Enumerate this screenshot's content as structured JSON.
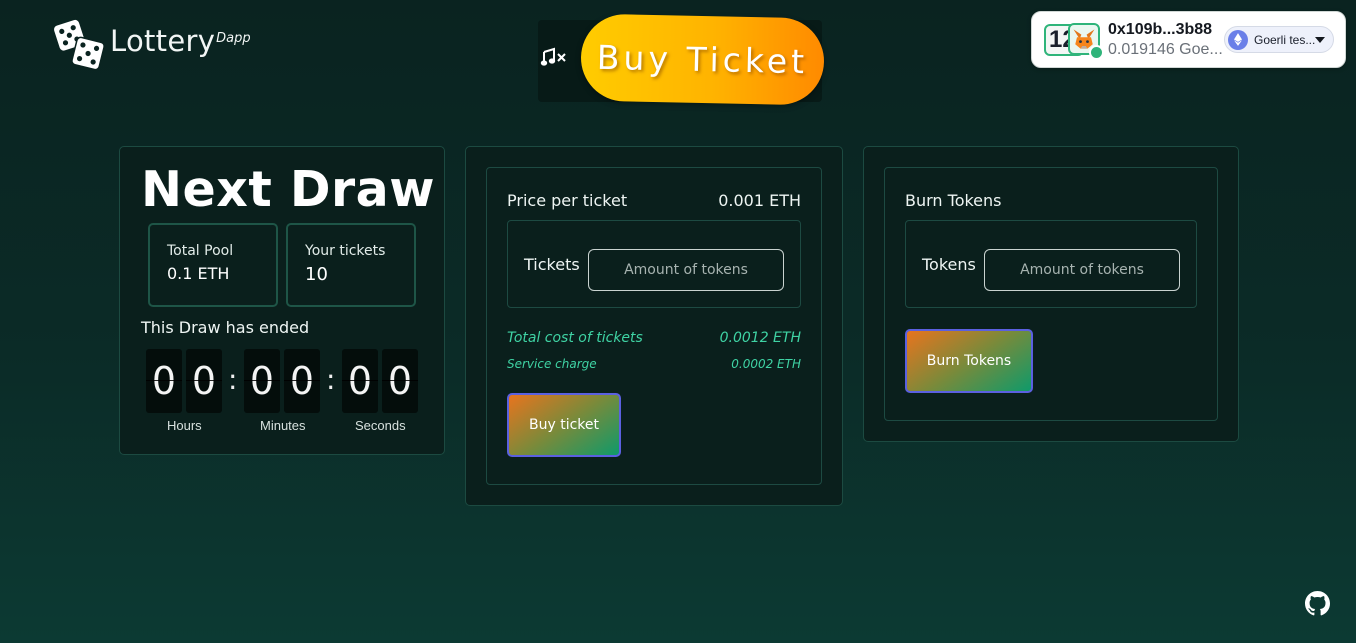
{
  "logo": {
    "title": "Lottery",
    "superscript": "Dapp"
  },
  "header": {
    "banner_label": "Buy Ticket",
    "music_icon": "music-muted-icon"
  },
  "wallet": {
    "number_badge": "12",
    "address": "0x109b...3b88",
    "balance": "0.019146 Goe...",
    "network": "Goerli tes..."
  },
  "draw": {
    "title": "Next Draw",
    "total_pool_label": "Total Pool",
    "total_pool_value": "0.1 ETH",
    "your_tickets_label": "Your tickets",
    "your_tickets_value": "10",
    "status": "This Draw has ended",
    "timer": {
      "h1": "0",
      "h2": "0",
      "m1": "0",
      "m2": "0",
      "s1": "0",
      "s2": "0",
      "sep": ":"
    },
    "labels": {
      "hours": "Hours",
      "minutes": "Minutes",
      "seconds": "Seconds"
    }
  },
  "ticket": {
    "price_label": "Price per ticket",
    "price_value": "0.001 ETH",
    "tickets_label": "Tickets",
    "tickets_placeholder": "Amount of tokens",
    "total_cost_label": "Total cost of tickets",
    "total_cost_value": "0.0012 ETH",
    "service_label": "Service charge",
    "service_value": "0.0002 ETH",
    "button": "Buy ticket"
  },
  "burn": {
    "title": "Burn Tokens",
    "tokens_label": "Tokens",
    "tokens_placeholder": "Amount of tokens",
    "button": "Burn Tokens"
  },
  "footer": {
    "icon": "github-icon"
  }
}
